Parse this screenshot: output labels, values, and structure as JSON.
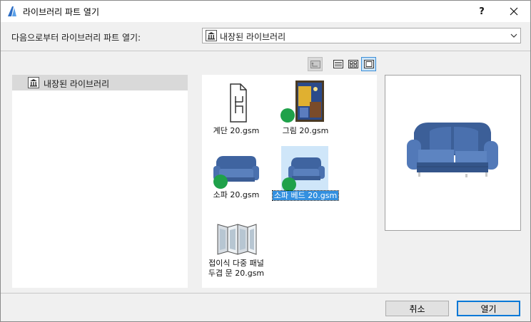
{
  "window": {
    "title": "라이브러리 파트 열기",
    "help_label": "?",
    "close_label": "✕"
  },
  "source": {
    "label": "다음으로부터 라이브러리 파트 열기:",
    "selected": "내장된 라이브러리"
  },
  "tree": {
    "items": [
      {
        "label": "내장된 라이브러리",
        "icon": "library-icon",
        "selected": true
      }
    ]
  },
  "view_modes": [
    {
      "name": "up-folder",
      "icon": "folder-up-icon",
      "enabled": false
    },
    {
      "name": "list",
      "icon": "list-view-icon",
      "enabled": true
    },
    {
      "name": "grid",
      "icon": "grid-view-icon",
      "enabled": true
    },
    {
      "name": "preview",
      "icon": "preview-view-icon",
      "enabled": true,
      "active": true
    }
  ],
  "parts": [
    {
      "caption": "계단 20.gsm",
      "icon": "document-chair-icon",
      "status": "none"
    },
    {
      "caption": "그림 20.gsm",
      "icon": "picture-frame-icon",
      "status": "green"
    },
    {
      "caption": "소파 20.gsm",
      "icon": "sofa-icon",
      "status": "green"
    },
    {
      "caption": "소파 베드 20.gsm",
      "icon": "sofa-bed-icon",
      "status": "green",
      "selected": true
    },
    {
      "caption_lines": [
        "접이식 다중 패널",
        "두겹 문 20.gsm"
      ],
      "icon": "folding-door-icon",
      "status": "none"
    }
  ],
  "colors": {
    "status_green": "#1fa14a",
    "selection": "#3390e0",
    "sofa_blue": "#4a6fa8"
  },
  "buttons": {
    "cancel": "취소",
    "open": "열기"
  }
}
